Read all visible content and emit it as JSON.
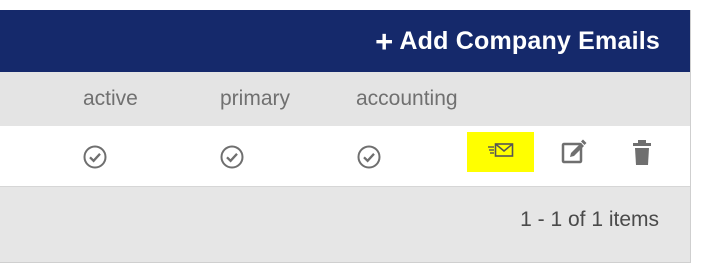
{
  "toolbar": {
    "add_plus": "+",
    "add_label": "Add Company Emails"
  },
  "table": {
    "columns": [
      "active",
      "primary",
      "accounting"
    ],
    "rows": [
      {
        "active": "check-circle-icon",
        "primary": "check-circle-icon",
        "accounting": "check-circle-icon"
      }
    ],
    "row_actions": [
      "send-email-icon",
      "edit-icon",
      "trash-icon"
    ]
  },
  "pager": {
    "text": "1 - 1 of 1 items"
  },
  "colors": {
    "header_bar": "#15296b",
    "highlight": "#ffff00",
    "icon": "#6f6f6f"
  }
}
